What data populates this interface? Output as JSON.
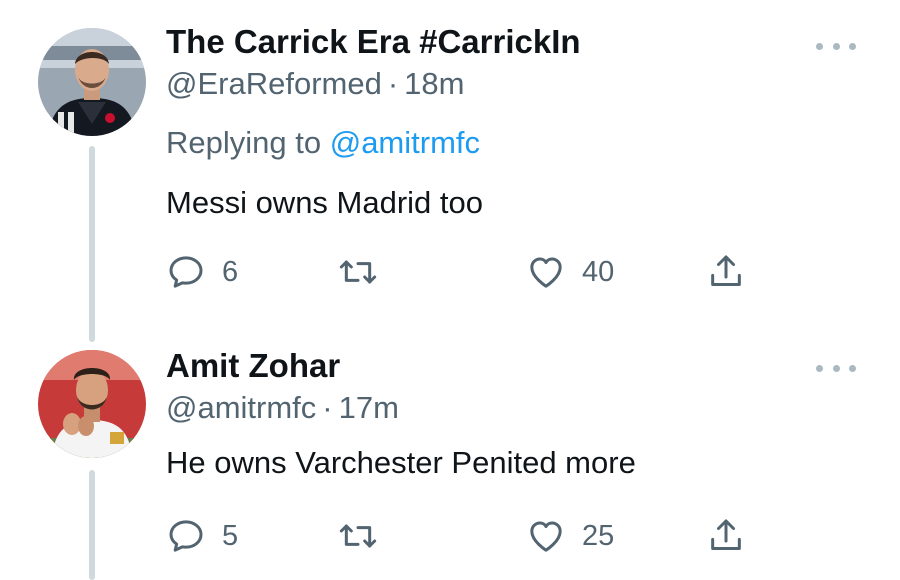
{
  "tweets": [
    {
      "display_name": "The Carrick Era #CarrickIn",
      "handle": "@EraReformed",
      "separator": "·",
      "time": "18m",
      "replying_prefix": "Replying to",
      "replying_to": "@amitrmfc",
      "text": "Messi owns Madrid too",
      "stats": {
        "replies": "6",
        "likes": "40"
      }
    },
    {
      "display_name": "Amit Zohar",
      "handle": "@amitrmfc",
      "separator": "·",
      "time": "17m",
      "text": "He owns Varchester Penited more",
      "stats": {
        "replies": "5",
        "likes": "25"
      }
    }
  ],
  "icons": {
    "reply": "reply-icon",
    "retweet": "retweet-icon",
    "like": "heart-icon",
    "share": "share-icon",
    "more": "more-options-icon"
  },
  "colors": {
    "text": "#0f1419",
    "secondary": "#536471",
    "mention": "#1d9bf0",
    "thread_line": "#cfd9de"
  }
}
